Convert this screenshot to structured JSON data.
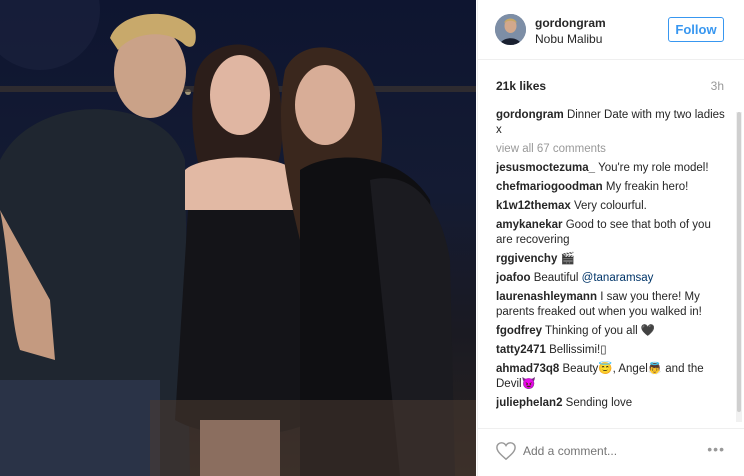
{
  "post": {
    "username": "gordongram",
    "location": "Nobu Malibu",
    "follow_label": "Follow",
    "likes": "21k likes",
    "time": "3h",
    "caption_user": "gordongram",
    "caption_text": "Dinner Date with my two ladies x",
    "view_all": "view all 67 comments"
  },
  "comments": [
    {
      "user": "jesusmoctezuma_",
      "text": "You're my role model!"
    },
    {
      "user": "chefmariogoodman",
      "text": "My freakin hero!"
    },
    {
      "user": "k1w12themax",
      "text": "Very colourful."
    },
    {
      "user": "amykanekar",
      "text": "Good to see that both of you are recovering"
    },
    {
      "user": "rggivenchy",
      "text": "🎬"
    },
    {
      "user": "joafoo",
      "text": "Beautiful ",
      "mention": "@tanaramsay"
    },
    {
      "user": "laurenashleymann",
      "text": "I saw you there! My parents freaked out when you walked in!"
    },
    {
      "user": "fgodfrey",
      "text": "Thinking of you all 🖤"
    },
    {
      "user": "tatty2471",
      "text": "Bellissimi!▯"
    },
    {
      "user": "ahmad73q8",
      "text": "Beauty😇, Angel👼 and the Devil😈"
    },
    {
      "user": "juliephelan2",
      "text": "Sending love"
    }
  ],
  "footer": {
    "add_comment_placeholder": "Add a comment...",
    "more_label": "•••"
  },
  "icons": {
    "heart": "heart-icon",
    "avatar": "avatar",
    "more": "more-options-icon"
  },
  "colors": {
    "accent": "#3897f0",
    "text": "#262626",
    "muted": "#999999",
    "mention": "#003569"
  }
}
